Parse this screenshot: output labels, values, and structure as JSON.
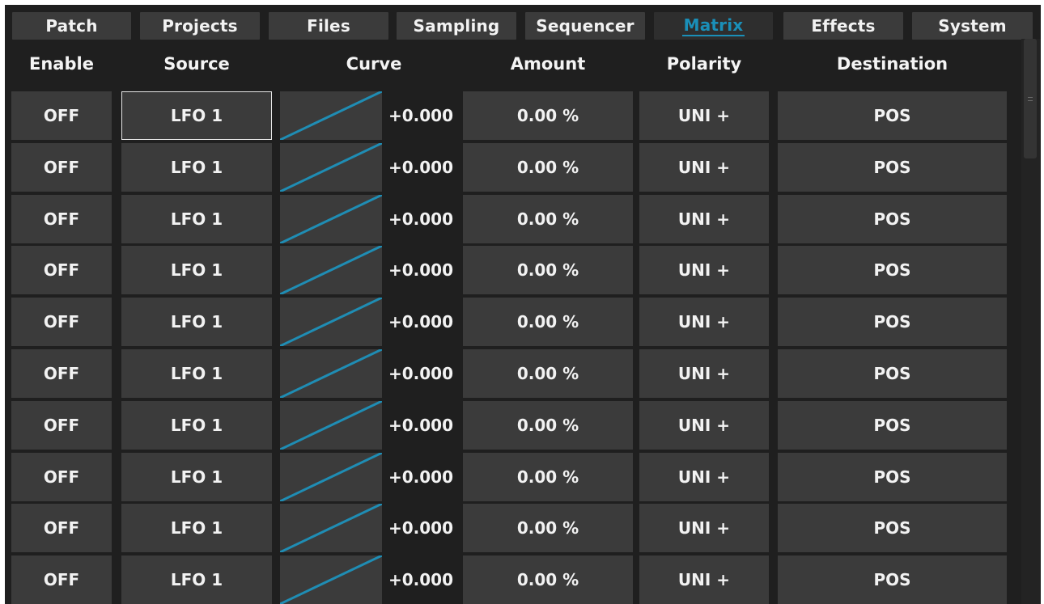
{
  "tabs": [
    {
      "label": "Patch",
      "active": false
    },
    {
      "label": "Projects",
      "active": false
    },
    {
      "label": "Files",
      "active": false
    },
    {
      "label": "Sampling",
      "active": false
    },
    {
      "label": "Sequencer",
      "active": false
    },
    {
      "label": "Matrix",
      "active": true
    },
    {
      "label": "Effects",
      "active": false
    },
    {
      "label": "System",
      "active": false
    }
  ],
  "headers": {
    "enable": "Enable",
    "source": "Source",
    "curve": "Curve",
    "amount": "Amount",
    "polarity": "Polarity",
    "destination": "Destination"
  },
  "rows": [
    {
      "enable": "OFF",
      "source": "LFO 1",
      "curve_value": "+0.000",
      "amount": "0.00 %",
      "polarity": "UNI +",
      "destination": "POS"
    },
    {
      "enable": "OFF",
      "source": "LFO 1",
      "curve_value": "+0.000",
      "amount": "0.00 %",
      "polarity": "UNI +",
      "destination": "POS"
    },
    {
      "enable": "OFF",
      "source": "LFO 1",
      "curve_value": "+0.000",
      "amount": "0.00 %",
      "polarity": "UNI +",
      "destination": "POS"
    },
    {
      "enable": "OFF",
      "source": "LFO 1",
      "curve_value": "+0.000",
      "amount": "0.00 %",
      "polarity": "UNI +",
      "destination": "POS"
    },
    {
      "enable": "OFF",
      "source": "LFO 1",
      "curve_value": "+0.000",
      "amount": "0.00 %",
      "polarity": "UNI +",
      "destination": "POS"
    },
    {
      "enable": "OFF",
      "source": "LFO 1",
      "curve_value": "+0.000",
      "amount": "0.00 %",
      "polarity": "UNI +",
      "destination": "POS"
    },
    {
      "enable": "OFF",
      "source": "LFO 1",
      "curve_value": "+0.000",
      "amount": "0.00 %",
      "polarity": "UNI +",
      "destination": "POS"
    },
    {
      "enable": "OFF",
      "source": "LFO 1",
      "curve_value": "+0.000",
      "amount": "0.00 %",
      "polarity": "UNI +",
      "destination": "POS"
    },
    {
      "enable": "OFF",
      "source": "LFO 1",
      "curve_value": "+0.000",
      "amount": "0.00 %",
      "polarity": "UNI +",
      "destination": "POS"
    },
    {
      "enable": "OFF",
      "source": "LFO 1",
      "curve_value": "+0.000",
      "amount": "0.00 %",
      "polarity": "UNI +",
      "destination": "POS"
    }
  ],
  "selected_row": 0,
  "colors": {
    "background": "#1f1f1f",
    "cell": "#3b3b3b",
    "text": "#f2f2f2",
    "accent": "#1a8fb8",
    "curve_line": "#1f8db4"
  }
}
